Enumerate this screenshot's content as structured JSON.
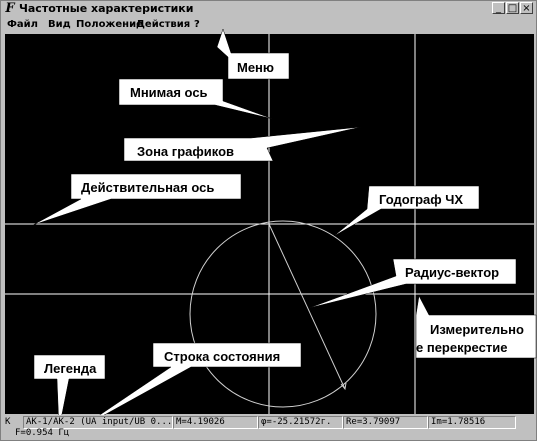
{
  "window": {
    "icon_glyph": "F",
    "title": "Частотные характеристики",
    "controls": [
      "_",
      "□",
      "×"
    ]
  },
  "menu": {
    "items": [
      "Файл",
      "Вид",
      "Положение",
      "Действия",
      "?"
    ]
  },
  "annotations": {
    "menu": "Меню",
    "imag_axis": "Мнимая ось",
    "plot_zone": "Зона графиков",
    "real_axis": "Действительная ось",
    "hodograph": "Годограф ЧХ",
    "radius_vector": "Радиус-вектор",
    "crosshair_line1": "Измерительно",
    "crosshair_line2": "е перекрестие",
    "status_line": "Строка состояния",
    "legend": "Легенда"
  },
  "status": {
    "k_label": "K",
    "channel": "AK-1/AK-2 (UA input/UB 0...",
    "magnitude": "M=4.19026",
    "phase": "φ=-25.21572г.",
    "real": "Re=3.79097",
    "imag": "Im=1.78516",
    "frequency": "F=0.954 Гц"
  },
  "colors": {
    "plot_background": "#000000",
    "axis_lines": "#ffffff",
    "hodograph_curve": "#d0d0d0",
    "callout_fill": "#ffffff",
    "window_chrome": "#c0c0c0"
  }
}
